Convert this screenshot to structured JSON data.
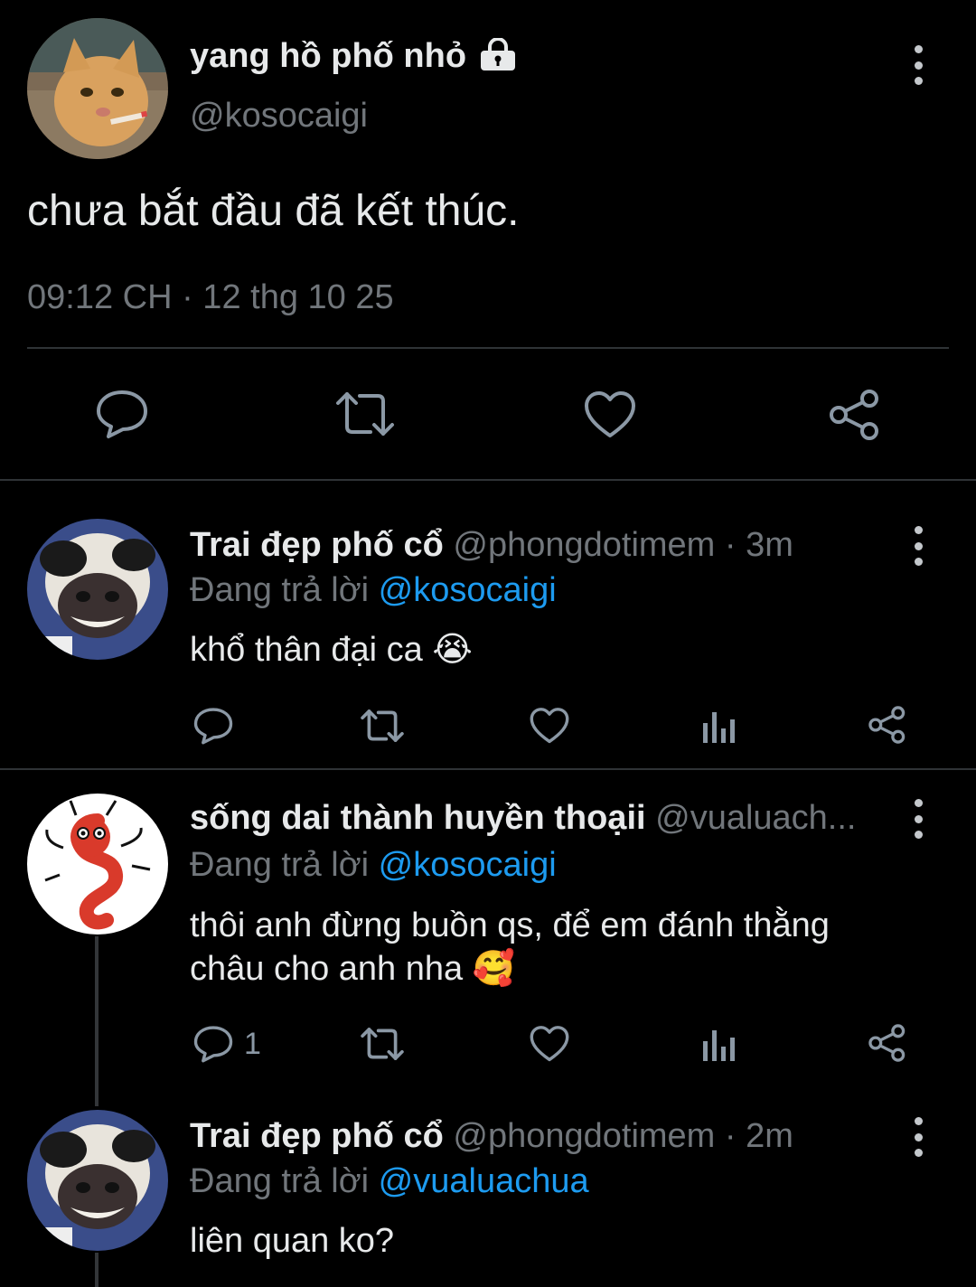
{
  "main_tweet": {
    "display_name": "yang hồ phố nhỏ",
    "handle": "@kosocaigi",
    "text": "chưa bắt đầu đã kết thúc.",
    "timestamp": "09:12 CH · 12 thg 10 25",
    "locked_icon": "lock-icon"
  },
  "replies": [
    {
      "display_name": "Trai đẹp phố cổ",
      "handle": "@phongdotimem",
      "time": "· 3m",
      "replying_prefix": "Đang trả lời",
      "replying_to": "@kosocaigi",
      "text": "khổ thân đại ca",
      "emoji": "😭",
      "reply_count": ""
    },
    {
      "display_name": "sống dai thành huyền thoạii",
      "handle": "@vualuach...",
      "time": "",
      "replying_prefix": "Đang trả lời",
      "replying_to": "@kosocaigi",
      "text_line1": "thôi anh đừng buồn qs, để em đánh thằng",
      "text_line2": "châu cho anh nha",
      "emoji": "🥰",
      "reply_count": "1"
    },
    {
      "display_name": "Trai đẹp phố cổ",
      "handle": "@phongdotimem",
      "time": "· 2m",
      "replying_prefix": "Đang trả lời",
      "replying_to": "@vualuachua",
      "text": "liên quan ko?"
    }
  ],
  "colors": {
    "background": "#000000",
    "text": "#e7e9ea",
    "secondary": "#71767b",
    "accent": "#1d9bf0",
    "divider": "#2f3336"
  }
}
